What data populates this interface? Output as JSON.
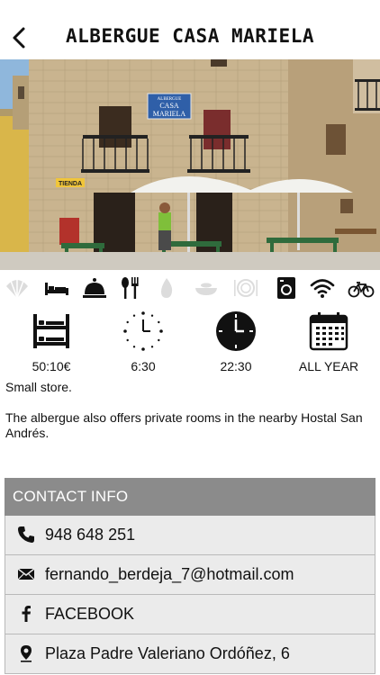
{
  "header": {
    "title": "ALBERGUE CASA MARIELA",
    "back_icon": "chevron-left-icon"
  },
  "photo": {
    "sign_line1": "ALBERGUE",
    "sign_line2": "CASA",
    "sign_line3": "MARIELA",
    "shop_sign": "TIENDA"
  },
  "amenities": [
    {
      "icon": "shell-icon",
      "active": false
    },
    {
      "icon": "bed-icon",
      "active": true
    },
    {
      "icon": "reception-bell-icon",
      "active": true
    },
    {
      "icon": "fork-spoon-icon",
      "active": true
    },
    {
      "icon": "fire-icon",
      "active": false
    },
    {
      "icon": "dish-icon",
      "active": false
    },
    {
      "icon": "plate-icon",
      "active": false
    },
    {
      "icon": "washing-machine-icon",
      "active": true
    },
    {
      "icon": "wifi-icon",
      "active": true
    },
    {
      "icon": "bicycle-icon",
      "active": true
    }
  ],
  "info": {
    "price": "50:10€",
    "opening": "6:30",
    "closing": "22:30",
    "season": "ALL YEAR"
  },
  "description": {
    "line1": "Small store.",
    "line2": "The albergue also offers private rooms in the nearby Hostal San Andrés."
  },
  "contact": {
    "heading": "CONTACT INFO",
    "phone": "948 648 251",
    "email": "fernando_berdeja_7@hotmail.com",
    "facebook": "FACEBOOK",
    "address": "Plaza Padre Valeriano Ordóñez, 6"
  },
  "colors": {
    "contact_header_bg": "#8b8b8b",
    "contact_row_bg": "#ebebeb",
    "inactive_icon": "#d9d9d9",
    "active_icon": "#111111"
  }
}
